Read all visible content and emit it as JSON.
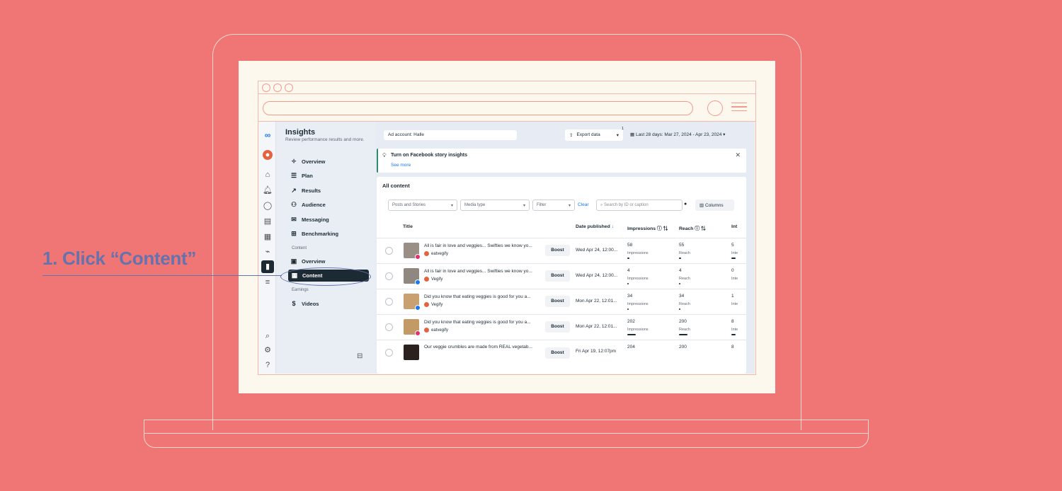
{
  "colors": {
    "background": "#ef7674",
    "callout": "#6672ad",
    "selected_nav": "#1c2b33",
    "link": "#1877f2"
  },
  "callout": {
    "text": "1. Click “Content”"
  },
  "header": {
    "title": "Insights",
    "subtitle": "Review performance results and more.",
    "ad_account": "Ad account: Halle",
    "export_label": "Export data",
    "export_badge": "1",
    "date_range": "Last 28 days: Mar 27, 2024 - Apr 23, 2024"
  },
  "sidebar": {
    "items": [
      {
        "label": "Overview",
        "icon": "sparkle-icon"
      },
      {
        "label": "Plan",
        "icon": "list-icon"
      },
      {
        "label": "Results",
        "icon": "trend-icon"
      },
      {
        "label": "Audience",
        "icon": "people-icon"
      },
      {
        "label": "Messaging",
        "icon": "chat-icon"
      },
      {
        "label": "Benchmarking",
        "icon": "benchmark-icon"
      }
    ],
    "content_section": "Content",
    "content_items": [
      {
        "label": "Overview",
        "icon": "overview-icon"
      },
      {
        "label": "Content",
        "icon": "table-icon",
        "selected": true
      }
    ],
    "earnings_section": "Earnings",
    "earnings_items": [
      {
        "label": "Videos",
        "icon": "dollar-icon"
      }
    ]
  },
  "banner": {
    "title": "Turn on Facebook story insights",
    "link": "See more"
  },
  "content": {
    "heading": "All content",
    "filters": {
      "type": "Posts and Stories",
      "media": "Media type",
      "filter": "Filter",
      "clear": "Clear"
    },
    "search_placeholder": "Search by ID or caption",
    "columns_label": "Columns",
    "headers": {
      "title": "Title",
      "date": "Date published",
      "impressions": "Impressions",
      "reach": "Reach",
      "interactions": "Int"
    },
    "rows": [
      {
        "caption": "All is fair in love and veggies... Swifties we know yo...",
        "account": "eatvegify",
        "platform": "instagram",
        "boost": "Boost",
        "date": "Wed Apr 24, 12:00...",
        "impressions": "58",
        "impressions_label": "Impressions",
        "reach": "55",
        "reach_label": "Reach",
        "interactions": "5",
        "interactions_label": "Inte"
      },
      {
        "caption": "All is fair in love and veggies... Swifties we know yo...",
        "account": "Vegify",
        "platform": "facebook",
        "boost": "Boost",
        "date": "Wed Apr 24, 12:00...",
        "impressions": "4",
        "impressions_label": "Impressions",
        "reach": "4",
        "reach_label": "Reach",
        "interactions": "0",
        "interactions_label": "Inte"
      },
      {
        "caption": "Did you know that eating veggies is good for you a...",
        "account": "Vegify",
        "platform": "facebook",
        "boost": "Boost",
        "date": "Mon Apr 22, 12:01...",
        "impressions": "34",
        "impressions_label": "Impressions",
        "reach": "34",
        "reach_label": "Reach",
        "interactions": "1",
        "interactions_label": "Inte"
      },
      {
        "caption": "Did you know that eating veggies is good for you a...",
        "account": "eatvegify",
        "platform": "instagram",
        "boost": "Boost",
        "date": "Mon Apr 22, 12:01...",
        "impressions": "202",
        "impressions_label": "Impressions",
        "reach": "200",
        "reach_label": "Reach",
        "interactions": "8",
        "interactions_label": "Inte"
      },
      {
        "caption": "Our veggie crumbles are made from REAL vegetab...",
        "account": "",
        "platform": "",
        "boost": "Boost",
        "date": "Fri Apr 19, 12:07pm",
        "impressions": "204",
        "impressions_label": "",
        "reach": "200",
        "reach_label": "",
        "interactions": "8",
        "interactions_label": ""
      }
    ]
  }
}
